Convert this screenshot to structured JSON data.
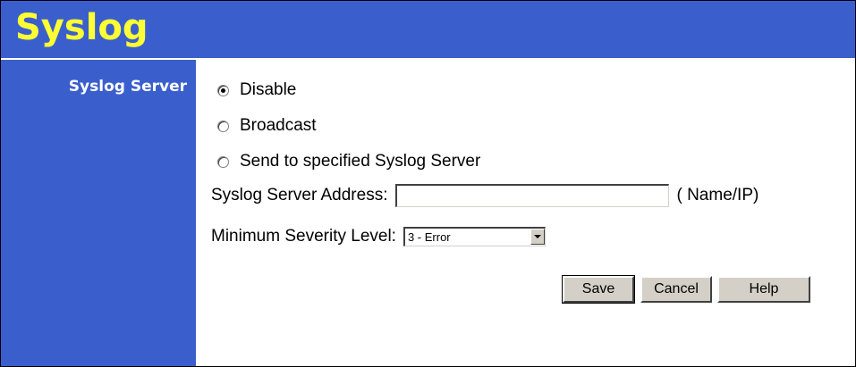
{
  "header": {
    "title": "Syslog"
  },
  "sidebar": {
    "label": "Syslog Server"
  },
  "options": {
    "disable": "Disable",
    "broadcast": "Broadcast",
    "send": "Send to specified Syslog Server",
    "selected": "Disable"
  },
  "address": {
    "label": "Syslog Server Address:",
    "value": "",
    "suffix": "( Name/IP)"
  },
  "severity": {
    "label": "Minimum Severity Level:",
    "value": "3 - Error"
  },
  "buttons": {
    "save": "Save",
    "cancel": "Cancel",
    "help": "Help"
  },
  "colors": {
    "background_blue": "#3a5fcd",
    "title_yellow": "#ffff33",
    "button_face": "#d4d0c8"
  }
}
